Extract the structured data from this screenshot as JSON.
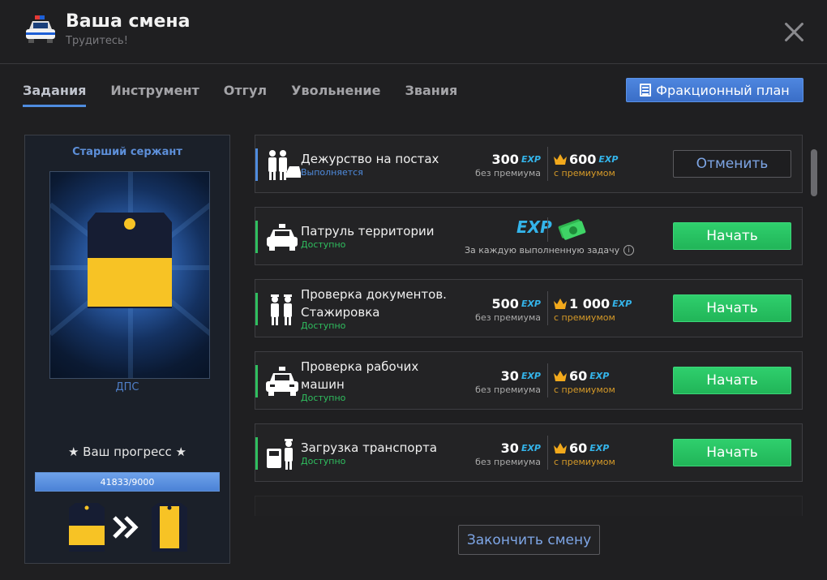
{
  "header": {
    "title": "Ваша смена",
    "subtitle": "Трудитесь!",
    "icon": "police-car-icon"
  },
  "tabs": [
    {
      "label": "Задания",
      "active": true
    },
    {
      "label": "Инструмент",
      "active": false
    },
    {
      "label": "Отгул",
      "active": false
    },
    {
      "label": "Увольнение",
      "active": false
    },
    {
      "label": "Звания",
      "active": false
    }
  ],
  "plan_button": {
    "label": "Фракционный план",
    "icon": "document-list-icon"
  },
  "rank": {
    "title": "Старший сержант",
    "unit": "ДПС",
    "progress_label": "★ Ваш прогресс ★",
    "progress_text": "41833/9000",
    "progress_fraction": 1.0
  },
  "tasks": [
    {
      "name": "Дежурство на постах",
      "status": "Выполняется",
      "status_color": "#4f8cdf",
      "bar_color": "#4f8cdf",
      "icon": "officers-car-icon",
      "free_value": "300",
      "free_caption": "без премиума",
      "prem_value": "600",
      "prem_caption": "с премиумом",
      "button": "Отменить"
    },
    {
      "name": "Патруль территории",
      "status": "Доступно",
      "status_color": "#2fbf5f",
      "bar_color": "#2fbf5f",
      "icon": "patrol-car-icon",
      "per_task_caption": "За каждую выполненную задачу",
      "button": "Начать"
    },
    {
      "name_line1": "Проверка документов.",
      "name_line2": "Стажировка",
      "status": "Доступно",
      "status_color": "#2fbf5f",
      "bar_color": "#2fbf5f",
      "icon": "two-officers-icon",
      "free_value": "500",
      "free_caption": "без премиума",
      "prem_value": "1 000",
      "prem_caption": "с премиумом",
      "button": "Начать"
    },
    {
      "name_line1": "Проверка рабочих",
      "name_line2": "машин",
      "status": "Доступно",
      "status_color": "#2fbf5f",
      "bar_color": "#2fbf5f",
      "icon": "police-car-front-icon",
      "free_value": "30",
      "free_caption": "без премиума",
      "prem_value": "60",
      "prem_caption": "с премиумом",
      "button": "Начать"
    },
    {
      "name": "Загрузка транспорта",
      "status": "Доступно",
      "status_color": "#2fbf5f",
      "bar_color": "#2fbf5f",
      "icon": "officer-loading-icon",
      "free_value": "30",
      "free_caption": "без премиума",
      "prem_value": "60",
      "prem_caption": "с премиумом",
      "button": "Начать"
    }
  ],
  "exp_label": "EXP",
  "finish_button": "Закончить смену"
}
